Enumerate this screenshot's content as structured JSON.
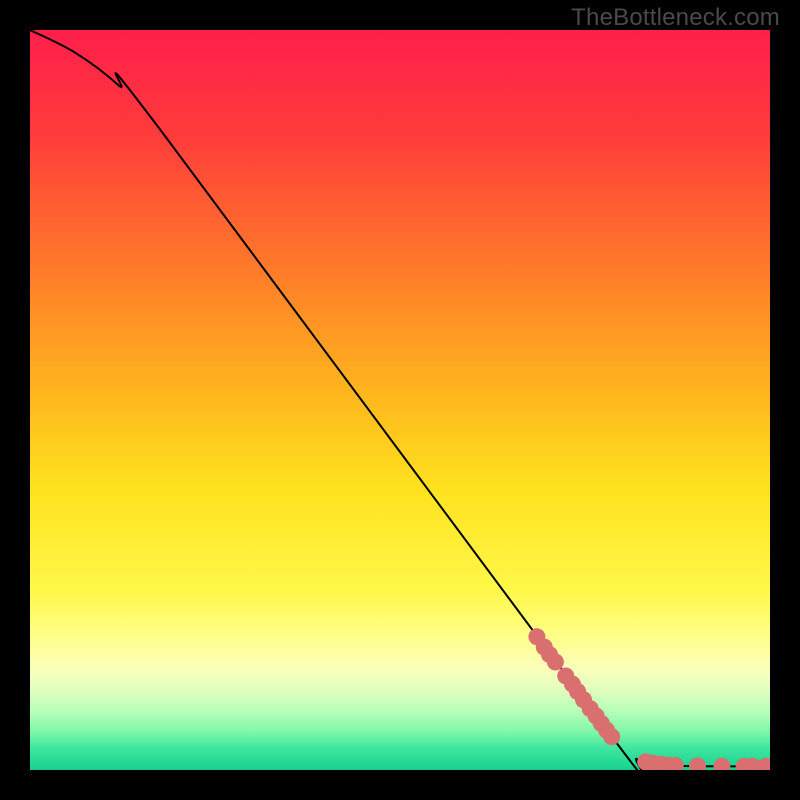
{
  "watermark": "TheBottleneck.com",
  "chart_data": {
    "type": "line",
    "title": "",
    "xlabel": "",
    "ylabel": "",
    "xlim": [
      0,
      100
    ],
    "ylim": [
      0,
      100
    ],
    "curve": [
      {
        "x": 0,
        "y": 100
      },
      {
        "x": 6,
        "y": 97
      },
      {
        "x": 12,
        "y": 92.5
      },
      {
        "x": 18,
        "y": 86
      },
      {
        "x": 79,
        "y": 4
      },
      {
        "x": 82,
        "y": 1.5
      },
      {
        "x": 86,
        "y": 0.6
      },
      {
        "x": 100,
        "y": 0.5
      }
    ],
    "points": [
      {
        "x": 68.5,
        "y": 18.0
      },
      {
        "x": 69.5,
        "y": 16.6
      },
      {
        "x": 70.2,
        "y": 15.6
      },
      {
        "x": 71.0,
        "y": 14.6
      },
      {
        "x": 72.4,
        "y": 12.7
      },
      {
        "x": 73.3,
        "y": 11.6
      },
      {
        "x": 74.0,
        "y": 10.6
      },
      {
        "x": 74.8,
        "y": 9.5
      },
      {
        "x": 75.7,
        "y": 8.3
      },
      {
        "x": 76.5,
        "y": 7.3
      },
      {
        "x": 77.2,
        "y": 6.3
      },
      {
        "x": 77.9,
        "y": 5.4
      },
      {
        "x": 78.6,
        "y": 4.5
      },
      {
        "x": 83.2,
        "y": 1.1
      },
      {
        "x": 84.2,
        "y": 0.9
      },
      {
        "x": 85.2,
        "y": 0.8
      },
      {
        "x": 86.2,
        "y": 0.65
      },
      {
        "x": 87.2,
        "y": 0.6
      },
      {
        "x": 90.2,
        "y": 0.55
      },
      {
        "x": 93.5,
        "y": 0.5
      },
      {
        "x": 96.5,
        "y": 0.5
      },
      {
        "x": 97.6,
        "y": 0.5
      },
      {
        "x": 99.4,
        "y": 0.5
      }
    ],
    "gradient_stops": [
      {
        "offset": 0,
        "color": "#ff1f4b"
      },
      {
        "offset": 14,
        "color": "#ff3b3b"
      },
      {
        "offset": 32,
        "color": "#ff7a2a"
      },
      {
        "offset": 48,
        "color": "#ffb21e"
      },
      {
        "offset": 62,
        "color": "#ffe21e"
      },
      {
        "offset": 76,
        "color": "#fff84a"
      },
      {
        "offset": 82,
        "color": "#ffff8a"
      },
      {
        "offset": 86,
        "color": "#fbffb8"
      },
      {
        "offset": 89,
        "color": "#e4ffc0"
      },
      {
        "offset": 92,
        "color": "#b8ffb8"
      },
      {
        "offset": 95,
        "color": "#7cf6a8"
      },
      {
        "offset": 97,
        "color": "#3fe6a0"
      },
      {
        "offset": 100,
        "color": "#17d18f"
      }
    ],
    "point_color": "#d96f6f",
    "curve_color": "#000000"
  }
}
